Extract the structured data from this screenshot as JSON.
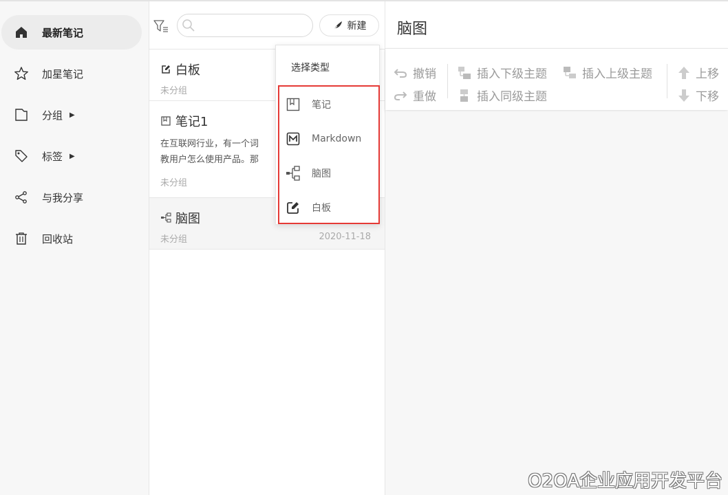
{
  "sidebar": {
    "items": [
      {
        "label": "最新笔记",
        "icon": "home-icon",
        "active": true
      },
      {
        "label": "加星笔记",
        "icon": "star-icon"
      },
      {
        "label": "分组",
        "icon": "folder-icon",
        "has_caret": true
      },
      {
        "label": "标签",
        "icon": "tag-icon",
        "has_caret": true
      },
      {
        "label": "与我分享",
        "icon": "share-icon"
      },
      {
        "label": "回收站",
        "icon": "trash-icon"
      }
    ]
  },
  "list": {
    "search_value": "",
    "new_button_label": "新建",
    "notes": [
      {
        "title": "白板",
        "type_icon": "whiteboard-icon",
        "group": "未分组",
        "date": ""
      },
      {
        "title": "笔记1",
        "type_icon": "note-icon",
        "preview_line1": "在互联网行业，有一个词",
        "preview_line2": "教用户怎么使用产品。那",
        "group": "未分组",
        "date": ""
      },
      {
        "title": "脑图",
        "type_icon": "mindmap-icon",
        "group": "未分组",
        "date": "2020-11-18",
        "selected": true
      }
    ]
  },
  "dropdown": {
    "title": "选择类型",
    "items": [
      {
        "label": "笔记",
        "icon": "note-icon"
      },
      {
        "label": "Markdown",
        "icon": "markdown-icon"
      },
      {
        "label": "脑图",
        "icon": "mindmap-icon"
      },
      {
        "label": "白板",
        "icon": "whiteboard-icon"
      }
    ]
  },
  "editor": {
    "title": "脑图",
    "toolbar": {
      "undo": "撤销",
      "redo": "重做",
      "insert_child": "插入下级主题",
      "insert_parent": "插入上级主题",
      "insert_sibling": "插入同级主题",
      "move_up": "上移",
      "move_down": "下移"
    }
  },
  "watermark": "O2OA企业应用开发平台",
  "colors": {
    "highlight_box": "#e53935",
    "sidebar_bg": "#f7f7f7",
    "toolbar_text": "#9a9a9a"
  }
}
